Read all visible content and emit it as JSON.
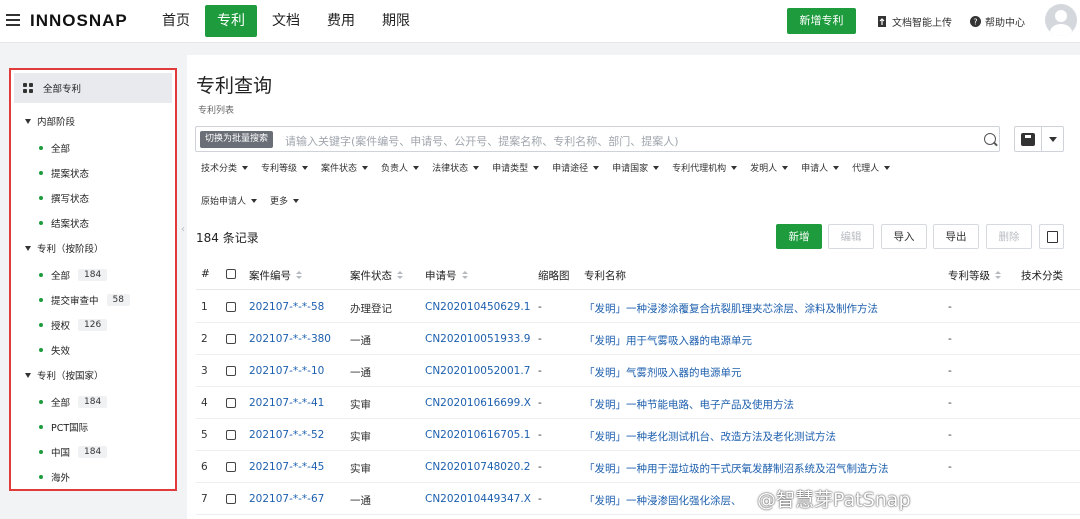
{
  "topbar": {
    "logo": "INNOSNAP",
    "nav": [
      "首页",
      "专利",
      "文档",
      "费用",
      "期限"
    ],
    "new_patent_label": "新增专利",
    "doc_upload_label": "文档智能上传",
    "help_label": "帮助中心"
  },
  "sidebar": {
    "all_label": "全部专利",
    "groups": [
      {
        "label": "内部阶段",
        "items": [
          {
            "label": "全部",
            "count": ""
          },
          {
            "label": "提案状态",
            "count": ""
          },
          {
            "label": "撰写状态",
            "count": ""
          },
          {
            "label": "结案状态",
            "count": ""
          }
        ]
      },
      {
        "label": "专利（按阶段）",
        "items": [
          {
            "label": "全部",
            "count": "184"
          },
          {
            "label": "提交审查中",
            "count": "58"
          },
          {
            "label": "授权",
            "count": "126"
          },
          {
            "label": "失效",
            "count": ""
          }
        ]
      },
      {
        "label": "专利（按国家）",
        "items": [
          {
            "label": "全部",
            "count": "184"
          },
          {
            "label": "PCT国际",
            "count": ""
          },
          {
            "label": "中国",
            "count": "184"
          },
          {
            "label": "海外",
            "count": ""
          }
        ]
      }
    ]
  },
  "main": {
    "title": "专利查询",
    "subtitle": "专利列表",
    "search": {
      "switch_label": "切换为批量搜索",
      "placeholder": "请输入关键字(案件编号、申请号、公开号、提案名称、专利名称、部门、提案人)"
    },
    "filters_row1": [
      "技术分类",
      "专利等级",
      "案件状态",
      "负责人",
      "法律状态",
      "申请类型",
      "申请途径",
      "申请国家",
      "专利代理机构",
      "发明人",
      "申请人",
      "代理人"
    ],
    "filters_row2": [
      "原始申请人",
      "更多"
    ],
    "records_label": "184 条记录",
    "toolbar": {
      "new": "新增",
      "edit": "编辑",
      "import": "导入",
      "export": "导出",
      "delete": "删除"
    },
    "table": {
      "headers": {
        "index": "#",
        "case_no": "案件编号",
        "status": "案件状态",
        "app_no": "申请号",
        "thumb": "缩略图",
        "name": "专利名称",
        "level": "专利等级",
        "tech": "技术分类"
      },
      "rows": [
        {
          "idx": "1",
          "case_no": "202107-*-*-58",
          "status": "办理登记",
          "app_no": "CN202010450629.1",
          "thumb": "-",
          "name": "「发明」一种浸渗涂覆复合抗裂肌理夹芯涂层、涂料及制作方法",
          "level": "-"
        },
        {
          "idx": "2",
          "case_no": "202107-*-*-380",
          "status": "一通",
          "app_no": "CN202010051933.9",
          "thumb": "-",
          "name": "「发明」用于气雾吸入器的电源单元",
          "level": "-"
        },
        {
          "idx": "3",
          "case_no": "202107-*-*-10",
          "status": "一通",
          "app_no": "CN202010052001.7",
          "thumb": "-",
          "name": "「发明」气雾剂吸入器的电源单元",
          "level": "-"
        },
        {
          "idx": "4",
          "case_no": "202107-*-*-41",
          "status": "实审",
          "app_no": "CN202010616699.X",
          "thumb": "-",
          "name": "「发明」一种节能电路、电子产品及使用方法",
          "level": "-"
        },
        {
          "idx": "5",
          "case_no": "202107-*-*-52",
          "status": "实审",
          "app_no": "CN202010616705.1",
          "thumb": "-",
          "name": "「发明」一种老化测试机台、改造方法及老化测试方法",
          "level": "-"
        },
        {
          "idx": "6",
          "case_no": "202107-*-*-45",
          "status": "实审",
          "app_no": "CN202010748020.2",
          "thumb": "-",
          "name": "「发明」一种用于湿垃圾的干式厌氧发酵制沼系统及沼气制造方法",
          "level": "-"
        },
        {
          "idx": "7",
          "case_no": "202107-*-*-67",
          "status": "一通",
          "app_no": "CN202010449347.X",
          "thumb": "-",
          "name": "「发明」一种浸渗固化强化涂层、",
          "level": ""
        }
      ]
    }
  },
  "watermark": "@智慧芽PatSnap"
}
